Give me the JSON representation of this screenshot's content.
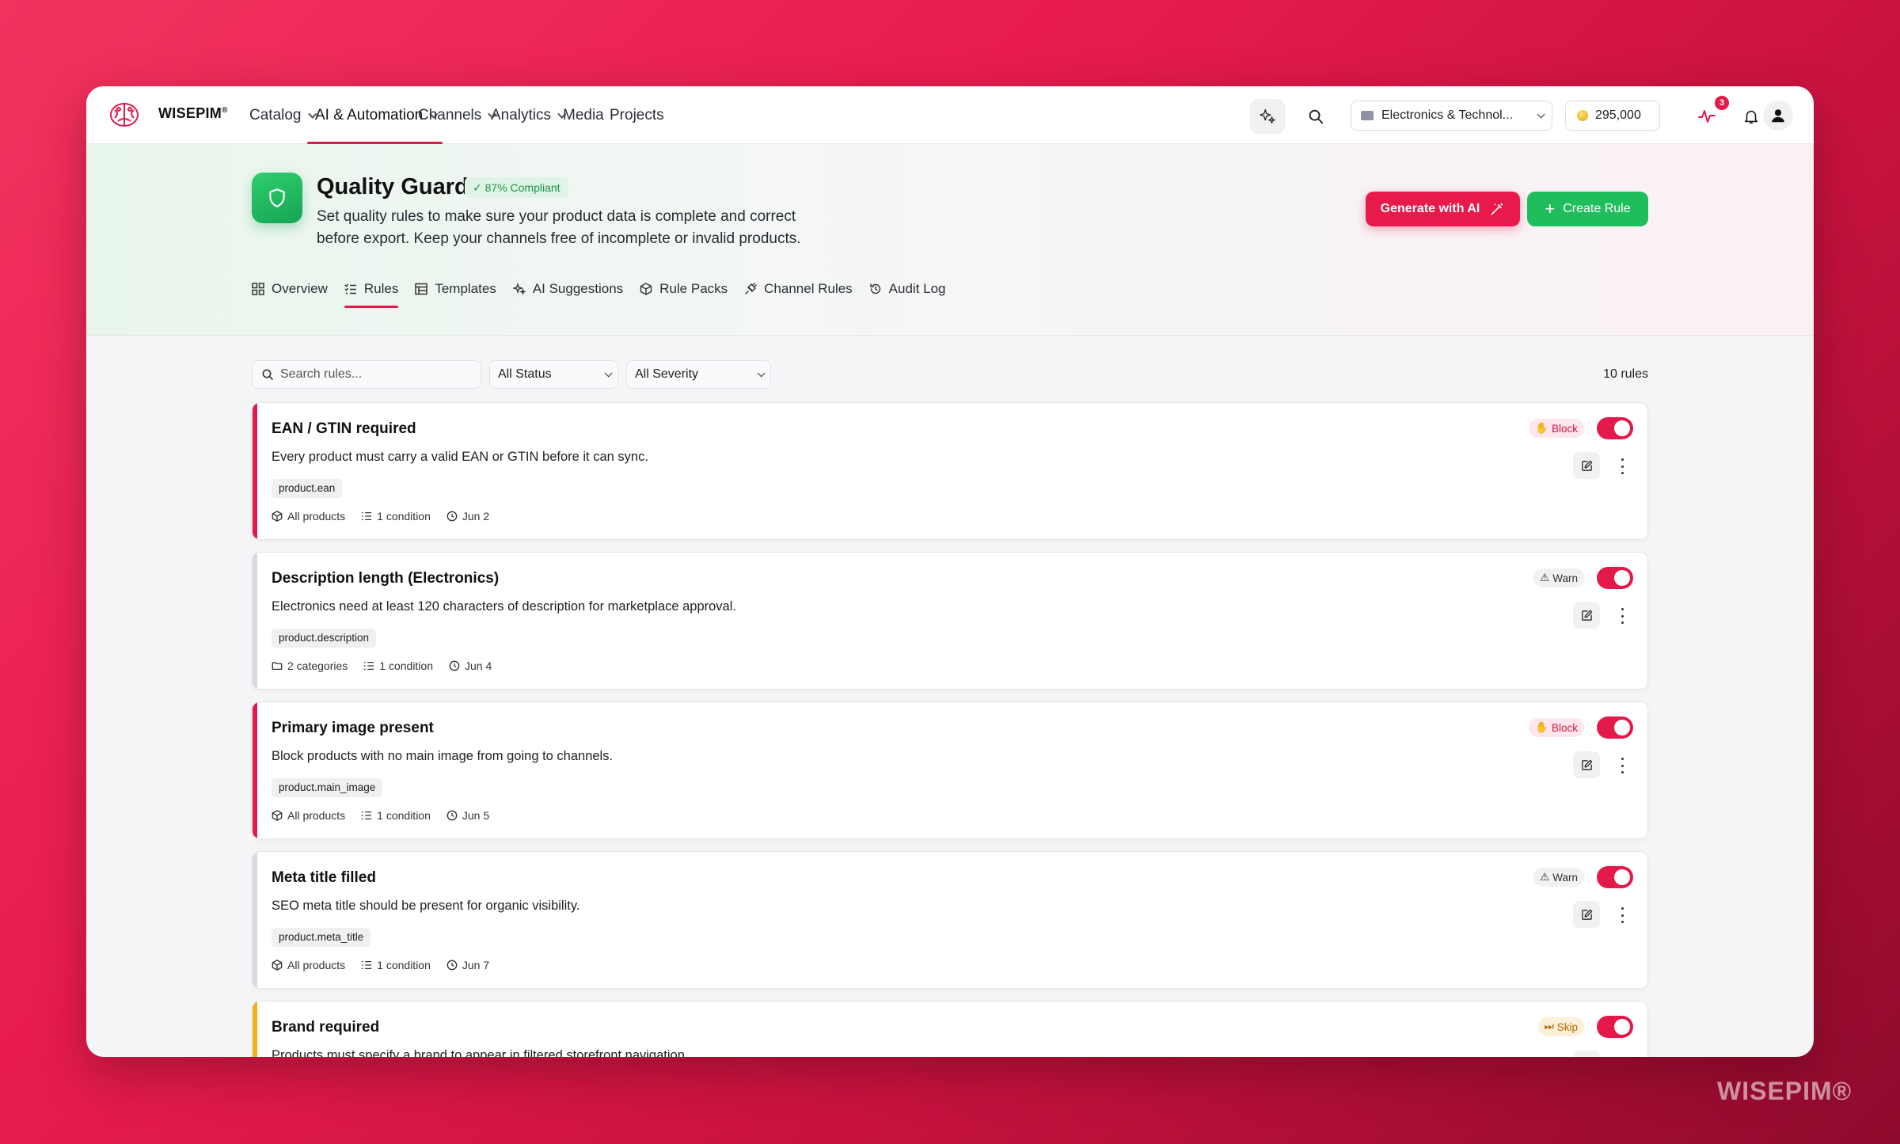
{
  "brand": {
    "name": "WISEPIM",
    "reg": "®"
  },
  "nav": {
    "items": [
      {
        "label": "Catalog",
        "dropdown": true
      },
      {
        "label": "AI & Automation",
        "dropdown": true,
        "active": true
      },
      {
        "label": "Channels",
        "dropdown": true
      },
      {
        "label": "Analytics",
        "dropdown": true
      },
      {
        "label": "Media",
        "dropdown": false
      },
      {
        "label": "Projects",
        "dropdown": false
      }
    ],
    "workspace": "Electronics & Technol...",
    "credits": "295,000",
    "activity_badge": "3"
  },
  "page": {
    "title": "Quality Guard",
    "compliance": "87% Compliant",
    "subtitle_line1": "Set quality rules to make sure your product data is complete and correct",
    "subtitle_line2": "before export. Keep your channels free of incomplete or invalid products.",
    "generate_label": "Generate with AI",
    "create_label": "Create Rule"
  },
  "tabs": [
    {
      "label": "Overview",
      "icon": "grid-icon"
    },
    {
      "label": "Rules",
      "icon": "list-check-icon",
      "active": true
    },
    {
      "label": "Templates",
      "icon": "template-icon"
    },
    {
      "label": "AI Suggestions",
      "icon": "sparkle-icon"
    },
    {
      "label": "Rule Packs",
      "icon": "box-icon"
    },
    {
      "label": "Channel Rules",
      "icon": "plug-icon"
    },
    {
      "label": "Audit Log",
      "icon": "history-icon"
    }
  ],
  "filters": {
    "search_placeholder": "Search rules...",
    "status": "All Status",
    "severity": "All Severity",
    "count": "10 rules"
  },
  "colors": {
    "block": "#e3194b",
    "warn": "#d8dadf",
    "skip": "#f2b01e",
    "accent": "#e3194b",
    "success": "#1fbd5c"
  },
  "rules": [
    {
      "title": "EAN / GTIN required",
      "description": "Every product must carry a valid EAN or GTIN before it can sync.",
      "field": "product.ean",
      "scope": "All products",
      "scope_icon": "cube-icon",
      "conditions": "1 condition",
      "date": "Jun 2",
      "severity": "Block",
      "enabled": true
    },
    {
      "title": "Description length (Electronics)",
      "description": "Electronics need at least 120 characters of description for marketplace approval.",
      "field": "product.description",
      "scope": "2 categories",
      "scope_icon": "folder-icon",
      "conditions": "1 condition",
      "date": "Jun 4",
      "severity": "Warn",
      "enabled": true
    },
    {
      "title": "Primary image present",
      "description": "Block products with no main image from going to channels.",
      "field": "product.main_image",
      "scope": "All products",
      "scope_icon": "cube-icon",
      "conditions": "1 condition",
      "date": "Jun 5",
      "severity": "Block",
      "enabled": true
    },
    {
      "title": "Meta title filled",
      "description": "SEO meta title should be present for organic visibility.",
      "field": "product.meta_title",
      "scope": "All products",
      "scope_icon": "cube-icon",
      "conditions": "1 condition",
      "date": "Jun 7",
      "severity": "Warn",
      "enabled": true
    },
    {
      "title": "Brand required",
      "description": "Products must specify a brand to appear in filtered storefront navigation.",
      "field": "",
      "scope": "",
      "scope_icon": "",
      "conditions": "",
      "date": "",
      "severity": "Skip",
      "enabled": true
    }
  ],
  "watermark": "WISEPIM®"
}
